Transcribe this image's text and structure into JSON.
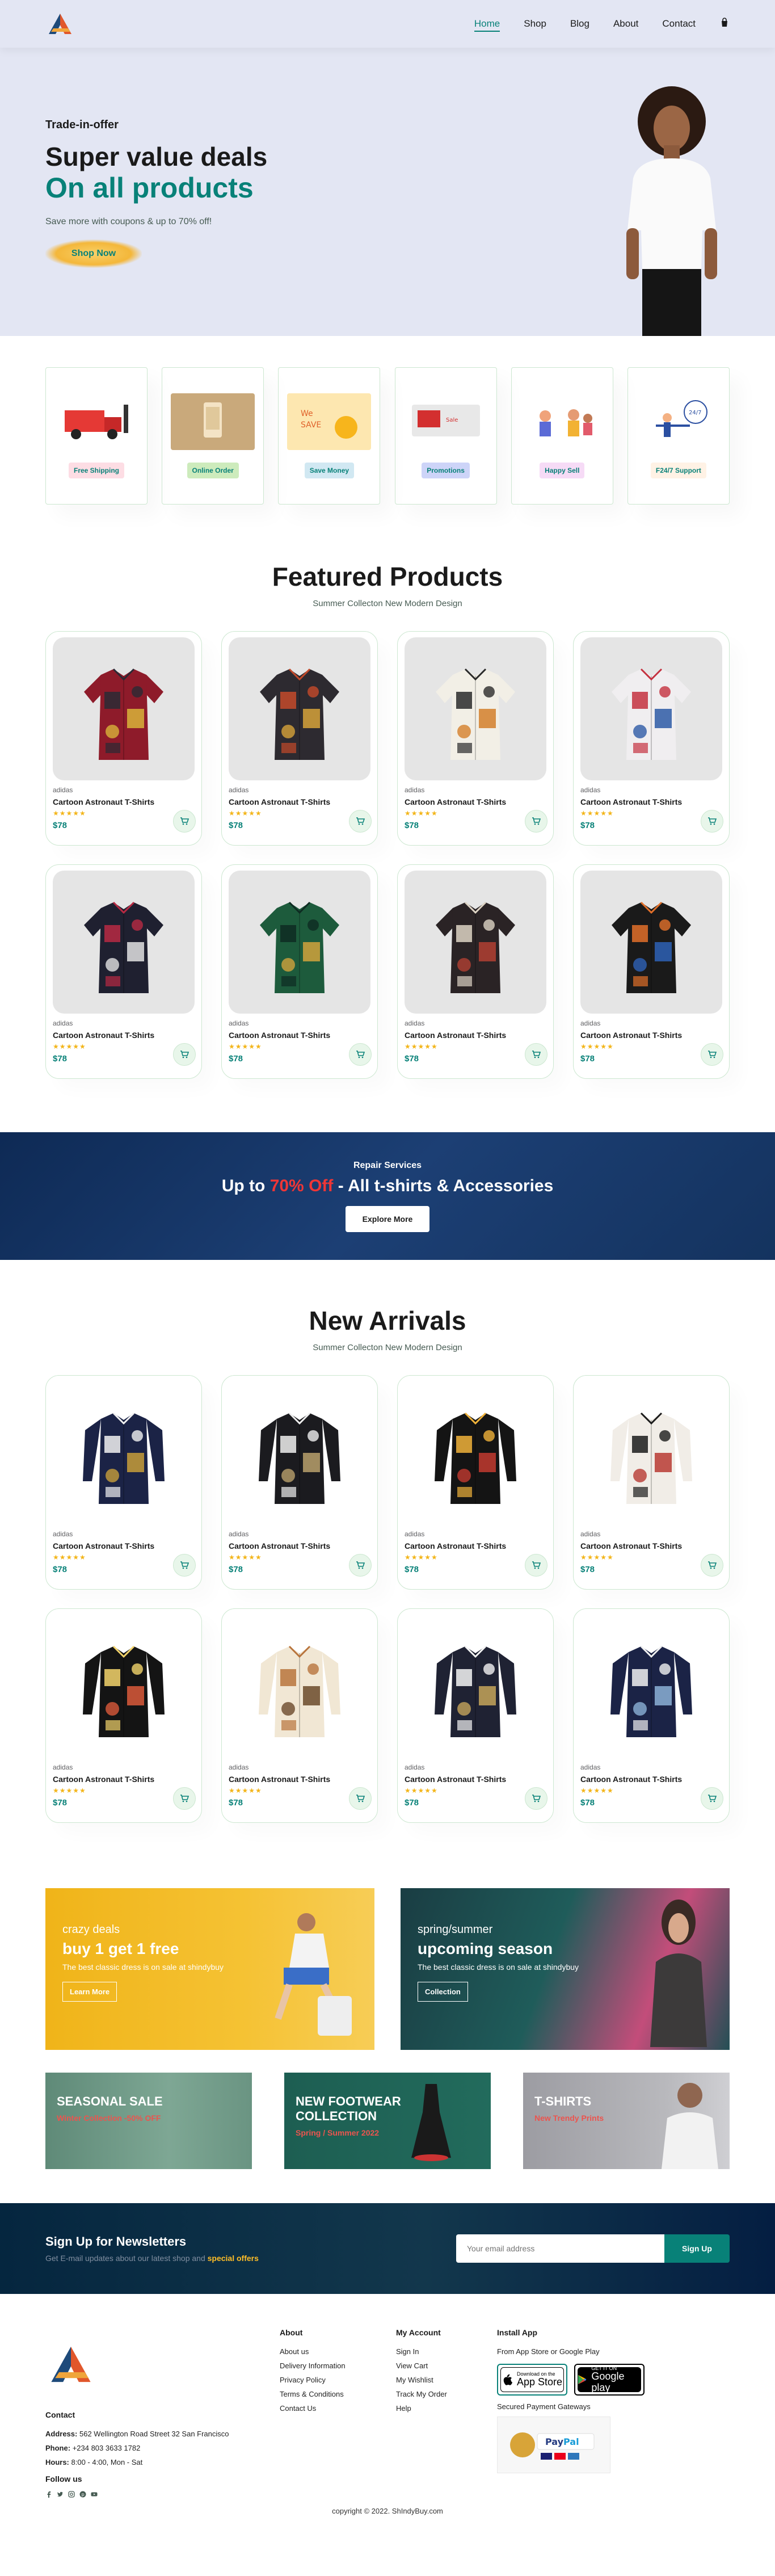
{
  "nav": {
    "items": [
      "Home",
      "Shop",
      "Blog",
      "About",
      "Contact"
    ],
    "active": "Home"
  },
  "hero": {
    "kicker": "Trade-in-offer",
    "title": "Super value deals",
    "subtitle": "On all products",
    "text": "Save more with coupons & up to 70% off!",
    "button": "Shop Now"
  },
  "features": [
    {
      "label": "Free Shipping",
      "tag_bg": "#fddde4"
    },
    {
      "label": "Online Order",
      "tag_bg": "#cdebbc"
    },
    {
      "label": "Save Money",
      "tag_bg": "#d1e8f2"
    },
    {
      "label": "Promotions",
      "tag_bg": "#cdd4f8"
    },
    {
      "label": "Happy Sell",
      "tag_bg": "#f6dbf6"
    },
    {
      "label": "F24/7 Support",
      "tag_bg": "#fff2e5"
    }
  ],
  "featured": {
    "title": "Featured Products",
    "subtitle": "Summer Collecton New Modern Design",
    "products": [
      {
        "brand": "adidas",
        "name": "Cartoon Astronaut T-Shirts",
        "stars": "★★★★★",
        "price": "$78"
      },
      {
        "brand": "adidas",
        "name": "Cartoon Astronaut T-Shirts",
        "stars": "★★★★★",
        "price": "$78"
      },
      {
        "brand": "adidas",
        "name": "Cartoon Astronaut T-Shirts",
        "stars": "★★★★★",
        "price": "$78"
      },
      {
        "brand": "adidas",
        "name": "Cartoon Astronaut T-Shirts",
        "stars": "★★★★★",
        "price": "$78"
      },
      {
        "brand": "adidas",
        "name": "Cartoon Astronaut T-Shirts",
        "stars": "★★★★★",
        "price": "$78"
      },
      {
        "brand": "adidas",
        "name": "Cartoon Astronaut T-Shirts",
        "stars": "★★★★★",
        "price": "$78"
      },
      {
        "brand": "adidas",
        "name": "Cartoon Astronaut T-Shirts",
        "stars": "★★★★★",
        "price": "$78"
      },
      {
        "brand": "adidas",
        "name": "Cartoon Astronaut T-Shirts",
        "stars": "★★★★★",
        "price": "$78"
      }
    ]
  },
  "repair_banner": {
    "kicker": "Repair Services",
    "title_pre": "Up to ",
    "title_hl": "70% Off",
    "title_post": " - All t-shirts & Accessories",
    "button": "Explore More"
  },
  "new_arrivals": {
    "title": "New Arrivals",
    "subtitle": "Summer Collecton New Modern Design",
    "products": [
      {
        "brand": "adidas",
        "name": "Cartoon Astronaut T-Shirts",
        "stars": "★★★★★",
        "price": "$78"
      },
      {
        "brand": "adidas",
        "name": "Cartoon Astronaut T-Shirts",
        "stars": "★★★★★",
        "price": "$78"
      },
      {
        "brand": "adidas",
        "name": "Cartoon Astronaut T-Shirts",
        "stars": "★★★★★",
        "price": "$78"
      },
      {
        "brand": "adidas",
        "name": "Cartoon Astronaut T-Shirts",
        "stars": "★★★★★",
        "price": "$78"
      },
      {
        "brand": "adidas",
        "name": "Cartoon Astronaut T-Shirts",
        "stars": "★★★★★",
        "price": "$78"
      },
      {
        "brand": "adidas",
        "name": "Cartoon Astronaut T-Shirts",
        "stars": "★★★★★",
        "price": "$78"
      },
      {
        "brand": "adidas",
        "name": "Cartoon Astronaut T-Shirts",
        "stars": "★★★★★",
        "price": "$78"
      },
      {
        "brand": "adidas",
        "name": "Cartoon Astronaut T-Shirts",
        "stars": "★★★★★",
        "price": "$78"
      }
    ]
  },
  "promo1": {
    "kicker": "crazy deals",
    "title": "buy 1 get 1 free",
    "text": "The best classic dress is on sale at shindybuy",
    "button": "Learn More"
  },
  "promo2": {
    "kicker": "spring/summer",
    "title": "upcoming season",
    "text": "The best classic dress is on sale at shindybuy",
    "button": "Collection"
  },
  "promo3": [
    {
      "title": "SEASONAL SALE",
      "sub": "Winter Collection -50% OFF"
    },
    {
      "title": "NEW FOOTWEAR COLLECTION",
      "sub": "Spring / Summer 2022"
    },
    {
      "title": "T-SHIRTS",
      "sub": "New Trendy Prints"
    }
  ],
  "newsletter": {
    "title": "Sign Up for Newsletters",
    "text_pre": "Get E-mail updates about our latest shop and ",
    "text_hl": "special offers",
    "placeholder": "Your email address",
    "button": "Sign Up"
  },
  "footer": {
    "contact_title": "Contact",
    "address_label": "Address:",
    "address": "562 Wellington Road Street 32 San Francisco",
    "phone_label": "Phone:",
    "phone": "+234 803 3633 1782",
    "hours_label": "Hours:",
    "hours": "8:00 - 4:00, Mon - Sat",
    "follow": "Follow us",
    "about_title": "About",
    "about_links": [
      "About us",
      "Delivery Information",
      "Privacy Policy",
      "Terms & Conditions",
      "Contact Us"
    ],
    "account_title": "My Account",
    "account_links": [
      "Sign In",
      "View Cart",
      "My Wishlist",
      "Track My Order",
      "Help"
    ],
    "app_title": "Install App",
    "app_text": "From App Store or Google Play",
    "appstore_small": "Download on the",
    "appstore_big": "App Store",
    "gplay_small": "GET IT ON",
    "gplay_big": "Google play",
    "payment_text": "Secured Payment Gateways",
    "copyright": "copyright © 2022. ShIndyBuy.com"
  }
}
